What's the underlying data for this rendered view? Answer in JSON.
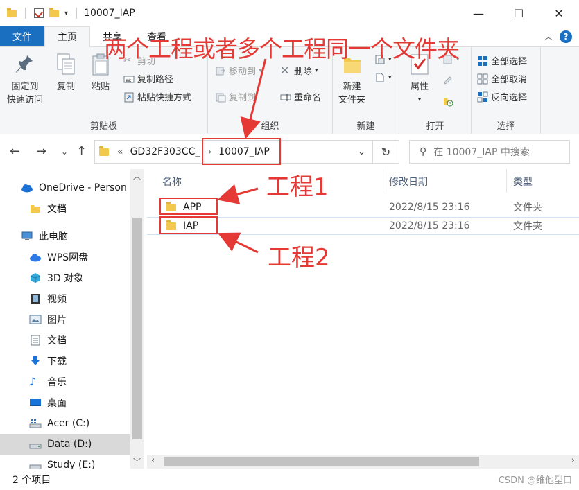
{
  "window": {
    "title": "10007_IAP",
    "minimize": "—",
    "maximize": "☐",
    "close": "✕"
  },
  "ribbon_tabs": {
    "file": "文件",
    "home": "主页",
    "share": "共享",
    "view": "查看"
  },
  "clipboard": {
    "pin": "固定到",
    "pin2": "快速访问",
    "copy": "复制",
    "paste": "粘贴",
    "cut": "剪切",
    "copy_path": "复制路径",
    "paste_shortcut": "粘贴快捷方式",
    "label": "剪贴板"
  },
  "organize": {
    "move_to": "移动到",
    "copy_to": "复制到",
    "delete": "删除",
    "rename": "重命名",
    "label": "组织"
  },
  "new_group": {
    "new_folder": "新建",
    "new_folder2": "文件夹",
    "label": "新建"
  },
  "open_group": {
    "properties": "属性",
    "label": "打开"
  },
  "select_group": {
    "select_all": "全部选择",
    "select_none": "全部取消",
    "invert": "反向选择",
    "label": "选择"
  },
  "address": {
    "prefix": "«",
    "parent": "GD32F303CC_",
    "current": "10007_IAP",
    "search_placeholder": "在 10007_IAP 中搜索"
  },
  "nav": {
    "onedrive": "OneDrive - Person",
    "docs1": "文档",
    "this_pc": "此电脑",
    "wps": "WPS网盘",
    "obj3d": "3D 对象",
    "video": "视频",
    "pictures": "图片",
    "docs2": "文档",
    "downloads": "下载",
    "music": "音乐",
    "desktop": "桌面",
    "drive_c": "Acer (C:)",
    "drive_d": "Data (D:)",
    "drive_e": "Study (E:)"
  },
  "columns": {
    "name": "名称",
    "modified": "修改日期",
    "type": "类型"
  },
  "files": [
    {
      "name": "APP",
      "modified": "2022/8/15 23:16",
      "type": "文件夹"
    },
    {
      "name": "IAP",
      "modified": "2022/8/15 23:16",
      "type": "文件夹"
    }
  ],
  "status": {
    "count": "2 个项目"
  },
  "watermark": "CSDN @维他型口",
  "annotations": {
    "headline": "两个工程或者多个工程同一个文件夹",
    "project1": "工程1",
    "project2": "工程2",
    "color": "#e53935"
  }
}
